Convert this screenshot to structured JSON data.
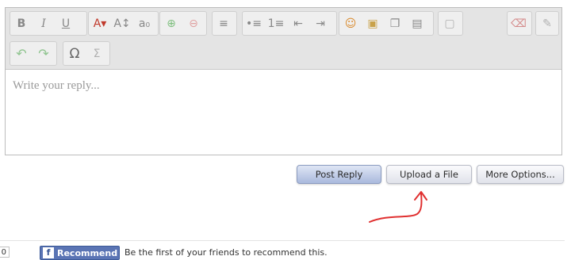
{
  "editor": {
    "placeholder": "Write your reply...",
    "toolbar": {
      "row1": [
        {
          "name": "bold-icon",
          "glyph": "B",
          "enabled": true
        },
        {
          "name": "italic-icon",
          "glyph": "I",
          "enabled": true
        },
        {
          "name": "underline-icon",
          "glyph": "U",
          "enabled": true
        },
        {
          "name": "text-color-icon",
          "glyph": "A▾",
          "enabled": true
        },
        {
          "name": "font-size-icon",
          "glyph": "A↕",
          "enabled": true
        },
        {
          "name": "font-family-icon",
          "glyph": "a₀",
          "enabled": true
        },
        {
          "name": "insert-link-icon",
          "glyph": "⊕",
          "enabled": false
        },
        {
          "name": "remove-link-icon",
          "glyph": "⊖",
          "enabled": false
        },
        {
          "name": "align-left-icon",
          "glyph": "≡",
          "enabled": true
        },
        {
          "name": "bulleted-list-icon",
          "glyph": "•≡",
          "enabled": true
        },
        {
          "name": "numbered-list-icon",
          "glyph": "1≡",
          "enabled": true
        },
        {
          "name": "outdent-icon",
          "glyph": "⇤",
          "enabled": true
        },
        {
          "name": "indent-icon",
          "glyph": "⇥",
          "enabled": true
        },
        {
          "name": "smilies-icon",
          "glyph": "☺",
          "enabled": true
        },
        {
          "name": "insert-image-icon",
          "glyph": "▣",
          "enabled": true
        },
        {
          "name": "insert-media-icon",
          "glyph": "❐",
          "enabled": true
        },
        {
          "name": "quote-icon",
          "glyph": "▤",
          "enabled": true
        },
        {
          "name": "save-draft-icon",
          "glyph": "▢",
          "enabled": false
        },
        {
          "name": "eraser-icon",
          "glyph": "⌫",
          "enabled": true
        },
        {
          "name": "settings-wrench-icon",
          "glyph": "✎",
          "enabled": false
        }
      ],
      "row2": [
        {
          "name": "undo-icon",
          "glyph": "↶",
          "enabled": false
        },
        {
          "name": "redo-icon",
          "glyph": "↷",
          "enabled": false
        },
        {
          "name": "special-characters-icon",
          "glyph": "Ω",
          "enabled": true
        },
        {
          "name": "sigma-icon",
          "glyph": "Σ",
          "enabled": false
        }
      ]
    }
  },
  "buttons": {
    "post_reply": "Post Reply",
    "upload_file": "Upload a File",
    "more_options": "More Options..."
  },
  "footer": {
    "count": "0",
    "recommend_label": "Recommend",
    "recommend_icon": "f",
    "social_text": "Be the first of your friends to recommend this."
  },
  "colors": {
    "toolbar_bg": "#e4e4e4",
    "primary_button": "#a9b9dc",
    "facebook_blue": "#5a74b4",
    "annotation_arrow": "#e03030"
  }
}
